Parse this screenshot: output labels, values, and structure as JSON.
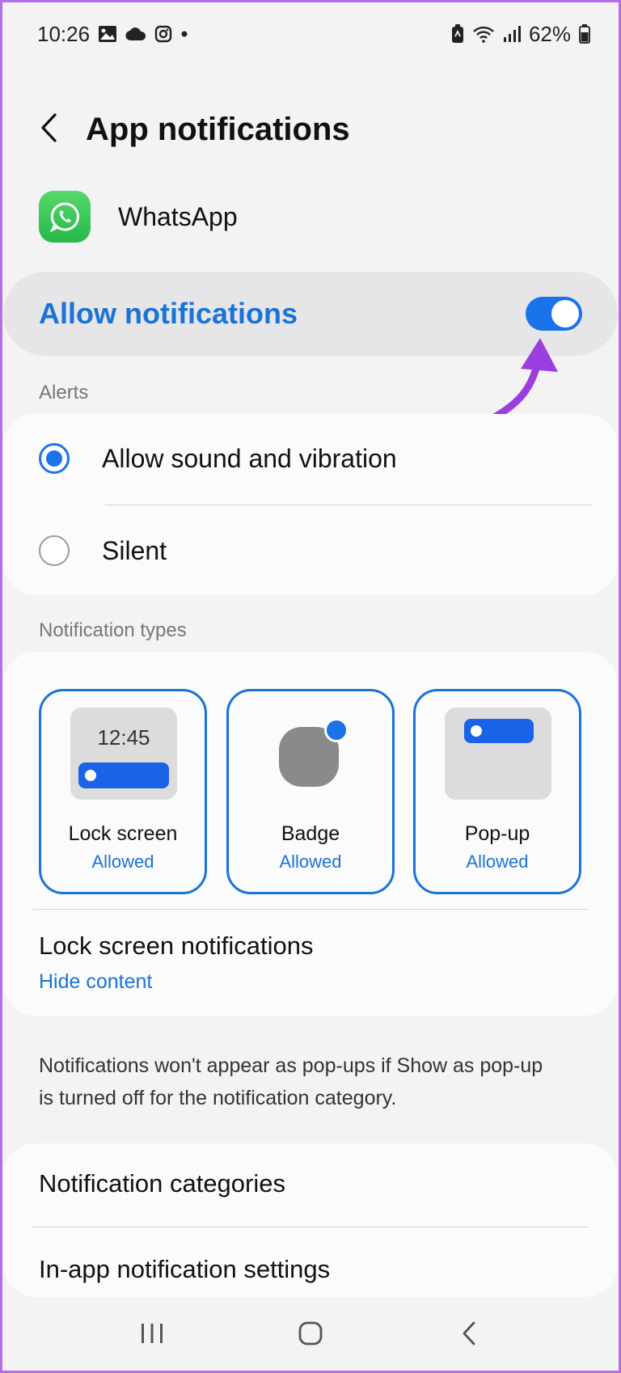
{
  "status_bar": {
    "time": "10:26",
    "battery": "62%",
    "left_icons": [
      "gallery-icon",
      "cloud-icon",
      "instagram-icon",
      "dot-icon"
    ],
    "right_icons": [
      "battery-saver-icon",
      "wifi-icon",
      "signal-icon",
      "battery-icon"
    ]
  },
  "header": {
    "title": "App notifications",
    "back_icon": "chevron-left-icon"
  },
  "app": {
    "name": "WhatsApp",
    "icon": "whatsapp-icon"
  },
  "allow_notifications": {
    "label": "Allow notifications",
    "enabled": true
  },
  "alerts": {
    "section_label": "Alerts",
    "options": [
      {
        "label": "Allow sound and vibration",
        "selected": true
      },
      {
        "label": "Silent",
        "selected": false
      }
    ]
  },
  "notification_types": {
    "section_label": "Notification types",
    "types": [
      {
        "title": "Lock screen",
        "status": "Allowed",
        "preview_time": "12:45"
      },
      {
        "title": "Badge",
        "status": "Allowed"
      },
      {
        "title": "Pop-up",
        "status": "Allowed"
      }
    ]
  },
  "lock_screen_notifications": {
    "title": "Lock screen notifications",
    "value": "Hide content"
  },
  "info": "Notifications won't appear as pop-ups if Show as pop-up is turned off for the notification category.",
  "menu": {
    "categories": "Notification categories",
    "in_app": "In-app notification settings"
  },
  "colors": {
    "accent": "#1a73e8",
    "annotation_arrow": "#9b3ee0"
  },
  "nav_bar": [
    "recents-icon",
    "home-icon",
    "back-icon"
  ]
}
